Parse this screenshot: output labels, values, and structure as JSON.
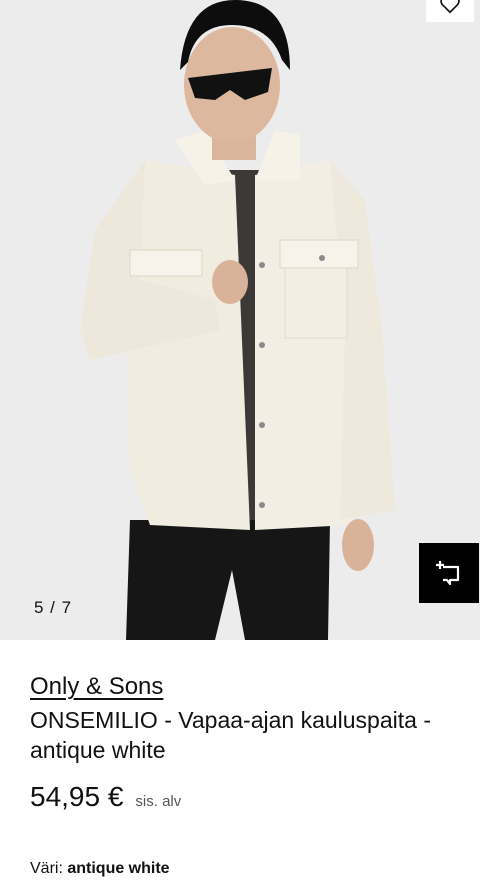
{
  "gallery": {
    "counter": "5 / 7",
    "image_icon": "product-photo",
    "wishlist_icon": "heart-icon",
    "similar_icon": "find-similar-icon"
  },
  "product": {
    "brand": "Only & Sons",
    "title": "ONSEMILIO - Vapaa-ajan kauluspaita - antique white",
    "price": "54,95 €",
    "vat_note": "sis. alv",
    "color_label": "Väri:",
    "color_value": "antique white"
  },
  "colors": {
    "accent": "#000000",
    "background": "#ffffff",
    "photo_background": "#ececec"
  }
}
